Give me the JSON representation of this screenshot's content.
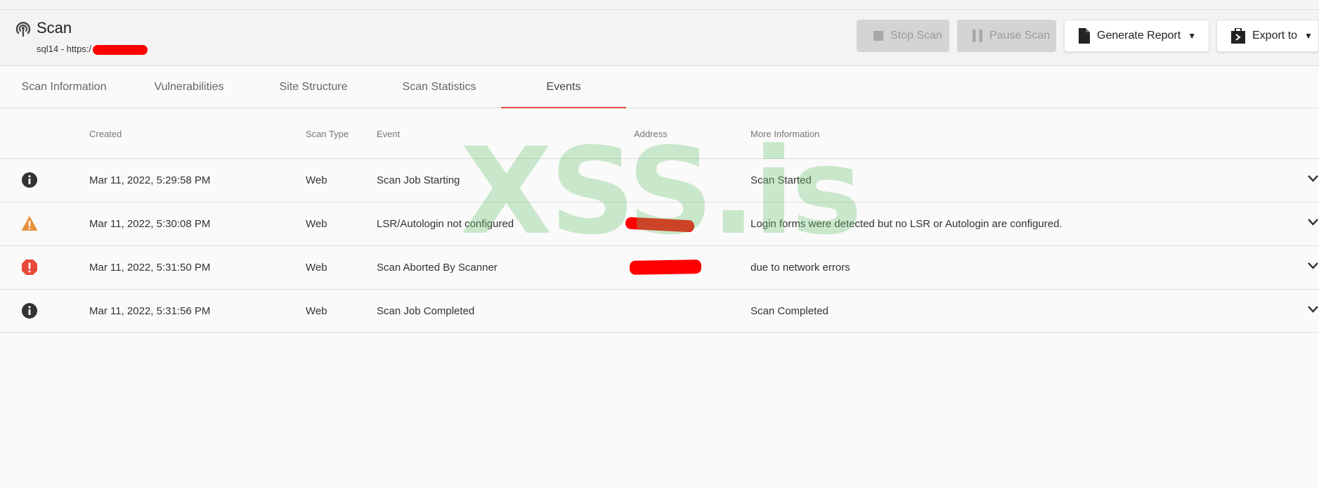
{
  "header": {
    "title": "Scan",
    "subtitle_prefix": "sql14 - https:/"
  },
  "toolbar": {
    "stop_label": "Stop Scan",
    "pause_label": "Pause Scan",
    "report_label": "Generate Report",
    "export_label": "Export to"
  },
  "tabs": [
    {
      "label": "Scan Information",
      "active": false
    },
    {
      "label": "Vulnerabilities",
      "active": false
    },
    {
      "label": "Site Structure",
      "active": false
    },
    {
      "label": "Scan Statistics",
      "active": false
    },
    {
      "label": "Events",
      "active": true
    }
  ],
  "table": {
    "columns": [
      "Created",
      "Scan Type",
      "Event",
      "Address",
      "More Information"
    ],
    "rows": [
      {
        "severity": "info",
        "created": "Mar 11, 2022, 5:29:58 PM",
        "scan_type": "Web",
        "event": "Scan Job Starting",
        "address": "",
        "info": "Scan Started"
      },
      {
        "severity": "warning",
        "created": "Mar 11, 2022, 5:30:08 PM",
        "scan_type": "Web",
        "event": "LSR/Autologin not configured",
        "address": "",
        "info": "Login forms were detected but no LSR or Autologin are configured."
      },
      {
        "severity": "error",
        "created": "Mar 11, 2022, 5:31:50 PM",
        "scan_type": "Web",
        "event": "Scan Aborted By Scanner",
        "address": "",
        "info": "due to network errors"
      },
      {
        "severity": "info",
        "created": "Mar 11, 2022, 5:31:56 PM",
        "scan_type": "Web",
        "event": "Scan Job Completed",
        "address": "",
        "info": "Scan Completed"
      }
    ]
  },
  "watermark": "XSS.is",
  "colors": {
    "accent": "#e04a3a",
    "info": "#333333",
    "warning": "#e8913a",
    "error": "#e84a3a",
    "watermark": "#6cc470",
    "redaction": "#ff0000"
  }
}
